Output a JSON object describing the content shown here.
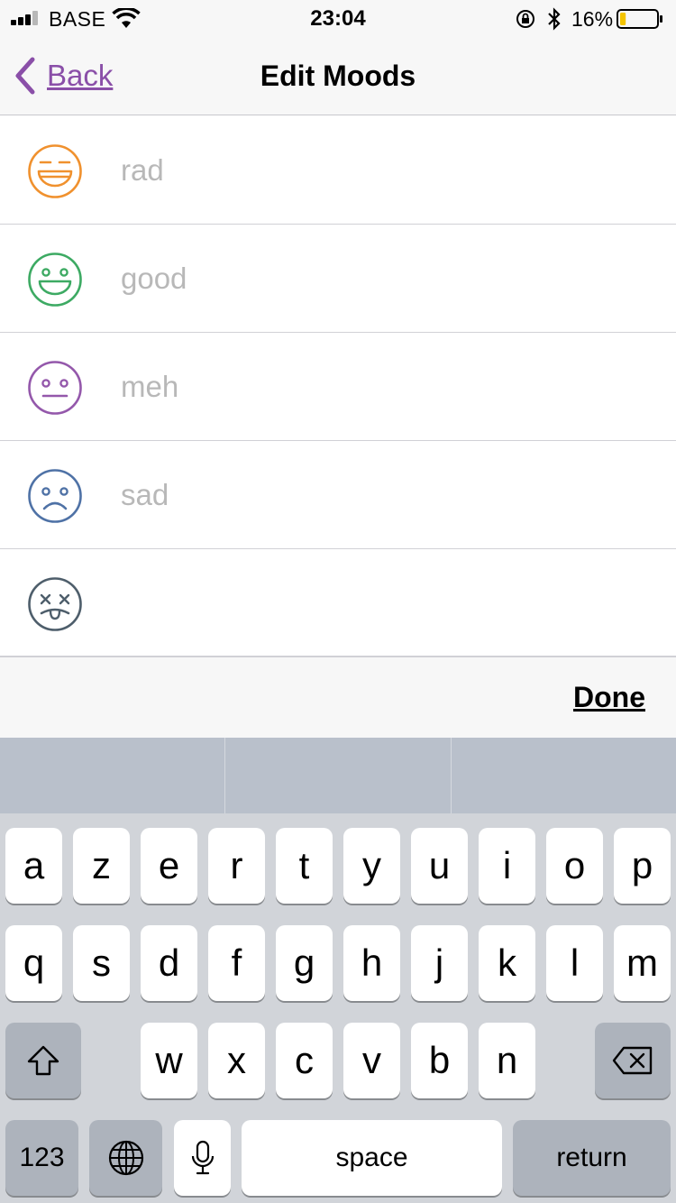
{
  "status_bar": {
    "carrier": "BASE",
    "time": "23:04",
    "battery_percent": "16%",
    "battery_level": 0.16,
    "signal_bars": 3,
    "icons": [
      "signal-icon",
      "wifi-icon",
      "rotation-lock-icon",
      "bluetooth-icon",
      "battery-icon"
    ]
  },
  "nav": {
    "back_label": "Back",
    "title": "Edit Moods"
  },
  "colors": {
    "accent": "#8a4fa8",
    "rad": "#f0912e",
    "good": "#3daa63",
    "meh": "#9458ab",
    "sad": "#4f72a6",
    "awful": "#4e5e6b"
  },
  "moods": [
    {
      "icon": "rad-face-icon",
      "placeholder": "rad",
      "value": ""
    },
    {
      "icon": "good-face-icon",
      "placeholder": "good",
      "value": ""
    },
    {
      "icon": "meh-face-icon",
      "placeholder": "meh",
      "value": ""
    },
    {
      "icon": "sad-face-icon",
      "placeholder": "sad",
      "value": ""
    },
    {
      "icon": "awful-face-icon",
      "placeholder": "",
      "value": ""
    }
  ],
  "toolbar": {
    "done_label": "Done"
  },
  "keyboard": {
    "row1": [
      "a",
      "z",
      "e",
      "r",
      "t",
      "y",
      "u",
      "i",
      "o",
      "p"
    ],
    "row2": [
      "q",
      "s",
      "d",
      "f",
      "g",
      "h",
      "j",
      "k",
      "l",
      "m"
    ],
    "row3": [
      "w",
      "x",
      "c",
      "v",
      "b",
      "n"
    ],
    "numbers_label": "123",
    "space_label": "space",
    "return_label": "return",
    "icons": [
      "shift-icon",
      "backspace-icon",
      "globe-icon",
      "microphone-icon"
    ]
  }
}
